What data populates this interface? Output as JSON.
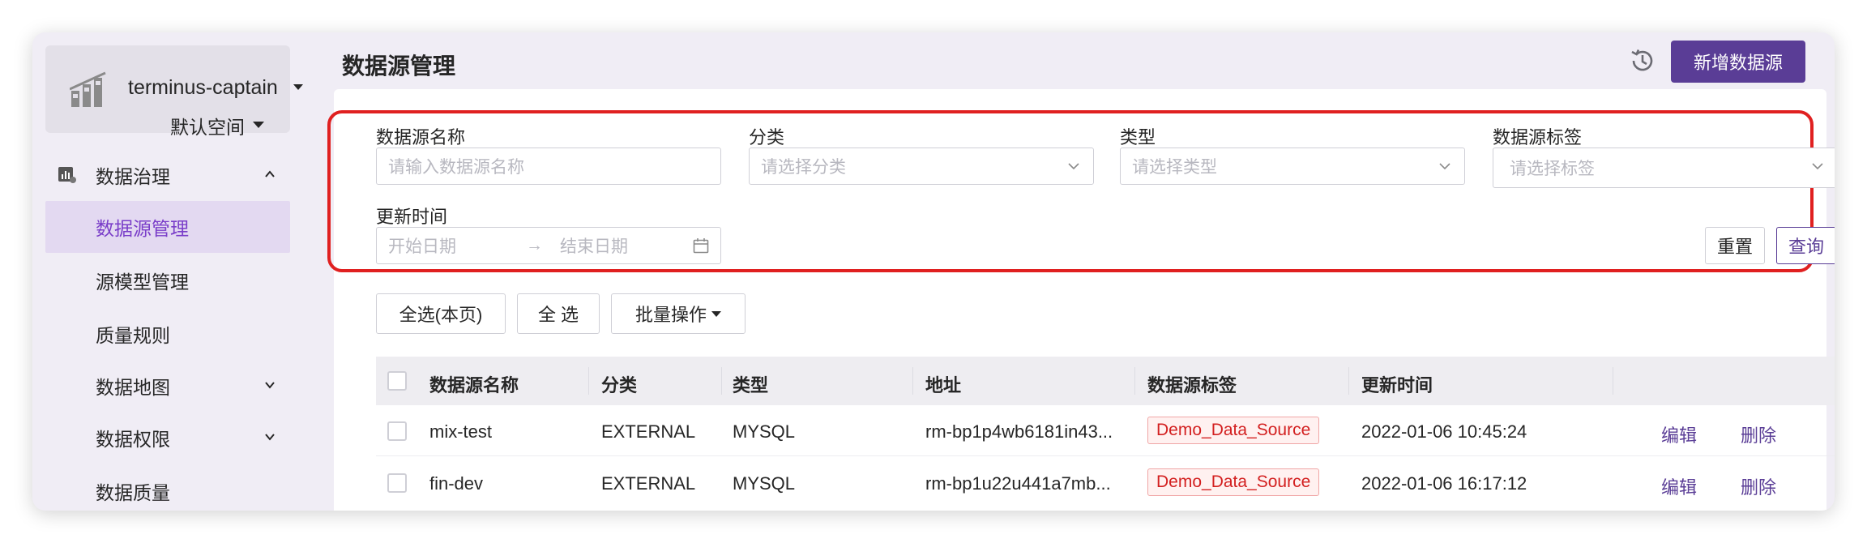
{
  "sidebar": {
    "workspace_name": "terminus-captain",
    "space_name": "默认空间",
    "nav": [
      {
        "label": "数据治理",
        "icon": "governance-icon",
        "expandable": true,
        "expanded": true
      },
      {
        "label": "数据源管理",
        "active": true
      },
      {
        "label": "源模型管理"
      },
      {
        "label": "质量规则"
      },
      {
        "label": "数据地图",
        "expandable": true
      },
      {
        "label": "数据权限",
        "expandable": true
      },
      {
        "label": "数据质量"
      }
    ]
  },
  "header": {
    "title": "数据源管理",
    "add_button": "新增数据源",
    "history_icon": "history-icon"
  },
  "filters": {
    "name_label": "数据源名称",
    "name_placeholder": "请输入数据源名称",
    "category_label": "分类",
    "category_placeholder": "请选择分类",
    "type_label": "类型",
    "type_placeholder": "请选择类型",
    "tag_label": "数据源标签",
    "tag_placeholder": "请选择标签",
    "time_label": "更新时间",
    "start_placeholder": "开始日期",
    "end_placeholder": "结束日期",
    "range_arrow": "→",
    "reset": "重置",
    "query": "查询"
  },
  "actions": {
    "select_page": "全选(本页)",
    "select_all": "全 选",
    "batch": "批量操作"
  },
  "table": {
    "columns": [
      "数据源名称",
      "分类",
      "类型",
      "地址",
      "数据源标签",
      "更新时间"
    ],
    "rows": [
      {
        "name": "mix-test",
        "category": "EXTERNAL",
        "type": "MYSQL",
        "address": "rm-bp1p4wb6181in43...",
        "tag": "Demo_Data_Source",
        "updated": "2022-01-06 10:45:24",
        "edit": "编辑",
        "delete": "删除"
      },
      {
        "name": "fin-dev",
        "category": "EXTERNAL",
        "type": "MYSQL",
        "address": "rm-bp1u22u441a7mb...",
        "tag": "Demo_Data_Source",
        "updated": "2022-01-06 16:17:12",
        "edit": "编辑",
        "delete": "删除"
      }
    ]
  },
  "colors": {
    "accent": "#5a3d96",
    "active_nav_bg": "#e3d9f1",
    "active_nav_text": "#7a3ec9",
    "highlight_border": "#e02020",
    "tag_text": "#d32020",
    "tag_bg": "#fff1f0"
  }
}
